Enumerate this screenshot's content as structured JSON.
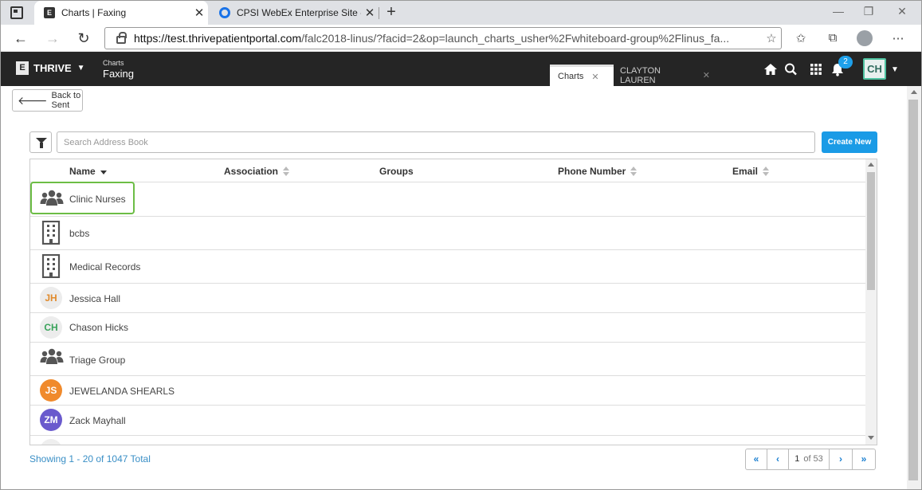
{
  "browser": {
    "tabs": [
      {
        "title": "Charts | Faxing",
        "active": true
      },
      {
        "title": "CPSI WebEx Enterprise Site - Rep",
        "active": false
      }
    ],
    "url_host": "https://test.thrivepatientportal.com",
    "url_path": "/falc2018-linus/?facid=2&op=launch_charts_usher%2Fwhiteboard-group%2Flinus_fa...",
    "new_tab_label": "+"
  },
  "app": {
    "brand": "THRIVE",
    "logo_letter": "E",
    "breadcrumb_small": "Charts",
    "breadcrumb_big": "Faxing",
    "tabs": [
      {
        "label": "Charts"
      },
      {
        "label": "CLAYTON LAUREN"
      }
    ],
    "notification_count": "2",
    "user_initials": "CH",
    "accent": "#1a9be6"
  },
  "page": {
    "back_label": "Back to Sent",
    "search_placeholder": "Search Address Book",
    "create_label": "Create New",
    "columns": {
      "name": "Name",
      "association": "Association",
      "groups": "Groups",
      "phone": "Phone Number",
      "email": "Email"
    },
    "rows": [
      {
        "name": "Clinic Nurses",
        "icon": "group-icon"
      },
      {
        "name": "bcbs",
        "icon": "building-icon"
      },
      {
        "name": "Medical Records",
        "icon": "building-icon"
      },
      {
        "name": "Jessica Hall",
        "initials": "JH",
        "avatar_bg": "#ececec",
        "avatar_fg": "#e08a2c"
      },
      {
        "name": "Chason Hicks",
        "initials": "CH",
        "avatar_bg": "#ececec",
        "avatar_fg": "#3aa35b"
      },
      {
        "name": "Triage Group",
        "icon": "group-icon"
      },
      {
        "name": "JEWELANDA SHEARLS",
        "initials": "JS",
        "avatar_bg": "#f08a2c",
        "avatar_fg": "#ffffff"
      },
      {
        "name": "Zack Mayhall",
        "initials": "ZM",
        "avatar_bg": "#6a5acd",
        "avatar_fg": "#ffffff"
      }
    ],
    "showing": "Showing 1 - 20 of 1047 Total",
    "pager": {
      "current": "1",
      "of_label": "of 53"
    }
  }
}
